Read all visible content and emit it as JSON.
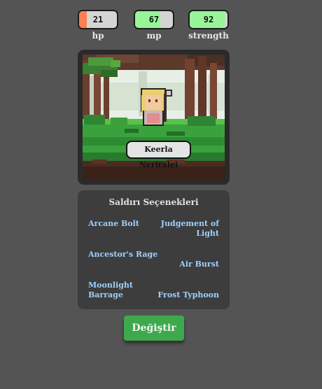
{
  "stats": [
    {
      "label": "hp",
      "value": "21",
      "level": 0.21,
      "color": "#ff7f50"
    },
    {
      "label": "mp",
      "value": "67",
      "level": 0.67,
      "color": "#98f598"
    },
    {
      "label": "strength",
      "value": "92",
      "level": 0.92,
      "color": "#98f598"
    }
  ],
  "character": {
    "name": "Keerla Neriralei"
  },
  "attacks": {
    "title": "Saldırı Seçenekleri",
    "items": [
      "Arcane Bolt",
      "Judgement of Light",
      "Ancestor's Rage",
      "Air Burst",
      "Moonlight Barrage",
      "Frost Typhoon"
    ]
  },
  "change_button": "Değiştir",
  "colors": {
    "background": "#545454",
    "panel": "#3d3d3d",
    "attack_text": "#9ed0ff",
    "button": "#3ea84d"
  }
}
